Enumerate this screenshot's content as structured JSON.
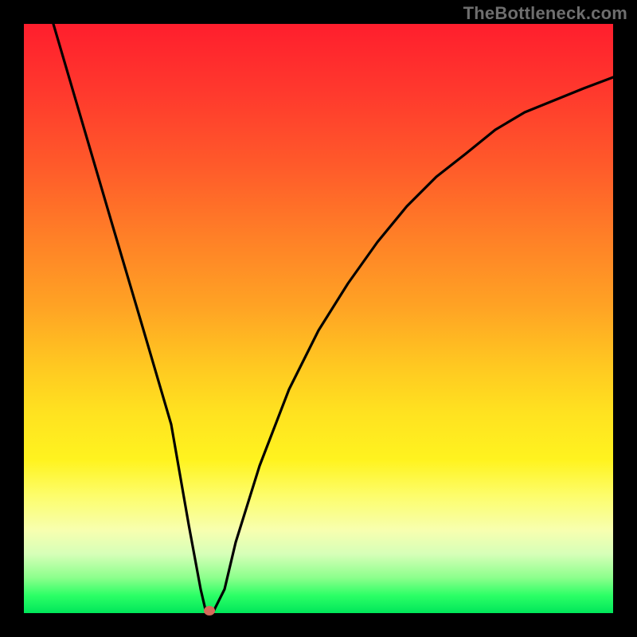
{
  "watermark_text": "TheBottleneck.com",
  "colors": {
    "curve": "#000000",
    "marker": "#d76a5a",
    "frame_bg": "#000000"
  },
  "chart_data": {
    "type": "line",
    "title": "",
    "xlabel": "",
    "ylabel": "",
    "xlim": [
      0,
      100
    ],
    "ylim": [
      0,
      100
    ],
    "annotations": [
      {
        "text": "TheBottleneck.com",
        "position": "top-right"
      }
    ],
    "series": [
      {
        "name": "bottleneck-curve",
        "x": [
          5,
          10,
          15,
          20,
          25,
          28,
          30,
          31,
          32,
          34,
          36,
          40,
          45,
          50,
          55,
          60,
          65,
          70,
          75,
          80,
          85,
          90,
          95,
          100
        ],
        "values": [
          100,
          83,
          66,
          49,
          32,
          15,
          4,
          0,
          0,
          4,
          12,
          25,
          38,
          48,
          56,
          63,
          69,
          74,
          78,
          82,
          85,
          87,
          89,
          91
        ]
      }
    ],
    "marker": {
      "x": 31.5,
      "y": 0
    },
    "gradient_stops": [
      {
        "pos": 0,
        "color": "#ff1e2d"
      },
      {
        "pos": 50,
        "color": "#ffc821"
      },
      {
        "pos": 80,
        "color": "#fdfd6a"
      },
      {
        "pos": 100,
        "color": "#00e65a"
      }
    ]
  }
}
